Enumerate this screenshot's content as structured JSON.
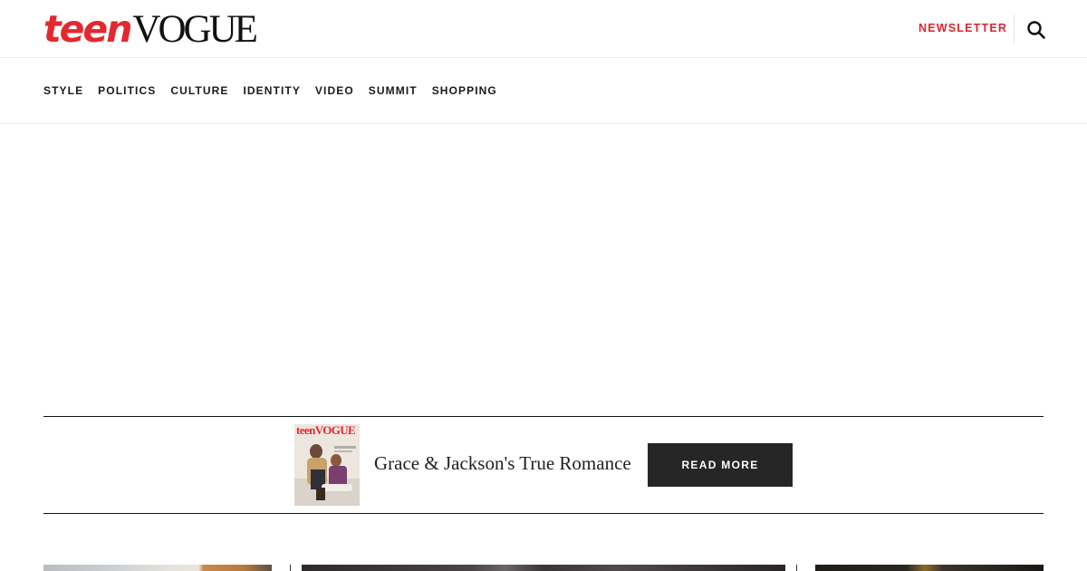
{
  "header": {
    "logo_teen": "teen",
    "logo_vogue": "VOGUE",
    "newsletter_label": "NEWSLETTER",
    "search_icon": "search-icon"
  },
  "nav": {
    "items": [
      {
        "label": "STYLE"
      },
      {
        "label": "POLITICS"
      },
      {
        "label": "CULTURE"
      },
      {
        "label": "IDENTITY"
      },
      {
        "label": "VIDEO"
      },
      {
        "label": "SUMMIT"
      },
      {
        "label": "SHOPPING"
      }
    ]
  },
  "promo": {
    "cover_logo": "teenVOGUE",
    "title": "Grace & Jackson's True Romance",
    "button_label": "READ MORE"
  },
  "colors": {
    "brand_red": "#e3282f",
    "newsletter_red": "#d8262e",
    "button_bg": "#262626"
  }
}
